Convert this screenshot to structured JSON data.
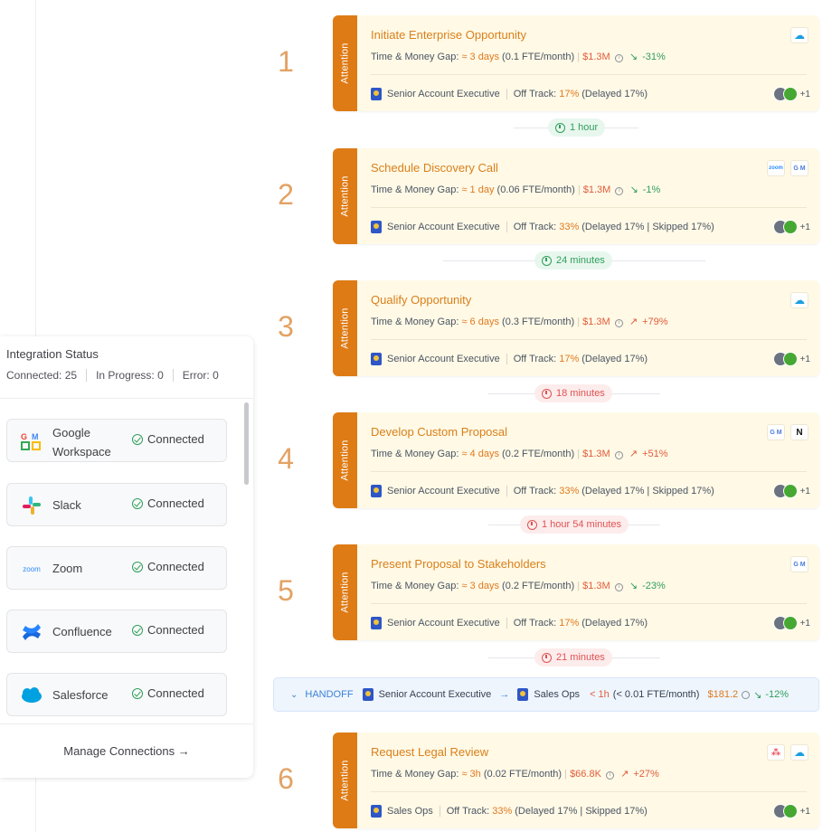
{
  "steps": [
    {
      "num": "1",
      "status": "Attention",
      "title": "Initiate Enterprise Opportunity",
      "gap_label": "Time & Money Gap:",
      "time_gap": "≈ 3 days",
      "fte": "(0.1 FTE/month)",
      "money": "$1.3M",
      "trend": "-31%",
      "trend_dir": "down",
      "role": "Senior Account Executive",
      "off_track_label": "Off Track:",
      "off_track_pct": "17%",
      "off_track_detail": "(Delayed 17%)",
      "avatars_more": "+1",
      "tools": [
        "salesforce-icon"
      ]
    },
    {
      "num": "2",
      "status": "Attention",
      "title": "Schedule Discovery Call",
      "gap_label": "Time & Money Gap:",
      "time_gap": "≈ 1 day",
      "fte": "(0.06 FTE/month)",
      "money": "$1.3M",
      "trend": "-1%",
      "trend_dir": "down",
      "role": "Senior Account Executive",
      "off_track_label": "Off Track:",
      "off_track_pct": "33%",
      "off_track_detail": "(Delayed 17% | Skipped 17%)",
      "avatars_more": "+1",
      "tools": [
        "zoom-icon",
        "google-workspace-icon"
      ]
    },
    {
      "num": "3",
      "status": "Attention",
      "title": "Qualify Opportunity",
      "gap_label": "Time & Money Gap:",
      "time_gap": "≈ 6 days",
      "fte": "(0.3 FTE/month)",
      "money": "$1.3M",
      "trend": "+79%",
      "trend_dir": "up",
      "role": "Senior Account Executive",
      "off_track_label": "Off Track:",
      "off_track_pct": "17%",
      "off_track_detail": "(Delayed 17%)",
      "avatars_more": "+1",
      "tools": [
        "salesforce-icon"
      ]
    },
    {
      "num": "4",
      "status": "Attention",
      "title": "Develop Custom Proposal",
      "gap_label": "Time & Money Gap:",
      "time_gap": "≈ 4 days",
      "fte": "(0.2 FTE/month)",
      "money": "$1.3M",
      "trend": "+51%",
      "trend_dir": "up",
      "role": "Senior Account Executive",
      "off_track_label": "Off Track:",
      "off_track_pct": "33%",
      "off_track_detail": "(Delayed 17% | Skipped 17%)",
      "avatars_more": "+1",
      "tools": [
        "google-workspace-icon",
        "notion-icon"
      ]
    },
    {
      "num": "5",
      "status": "Attention",
      "title": "Present Proposal to Stakeholders",
      "gap_label": "Time & Money Gap:",
      "time_gap": "≈ 3 days",
      "fte": "(0.2 FTE/month)",
      "money": "$1.3M",
      "trend": "-23%",
      "trend_dir": "down",
      "role": "Senior Account Executive",
      "off_track_label": "Off Track:",
      "off_track_pct": "17%",
      "off_track_detail": "(Delayed 17%)",
      "avatars_more": "+1",
      "tools": [
        "google-workspace-icon"
      ]
    },
    {
      "num": "6",
      "status": "Attention",
      "title": "Request Legal Review",
      "gap_label": "Time & Money Gap:",
      "time_gap": "≈ 3h",
      "fte": "(0.02 FTE/month)",
      "money": "$66.8K",
      "trend": "+27%",
      "trend_dir": "up",
      "role": "Sales Ops",
      "off_track_label": "Off Track:",
      "off_track_pct": "33%",
      "off_track_detail": "(Delayed 17% | Skipped 17%)",
      "avatars_more": "+1",
      "tools": [
        "asana-icon",
        "salesforce-icon"
      ]
    }
  ],
  "durations": [
    {
      "text": "1 hour",
      "tone": "green"
    },
    {
      "text": "24 minutes",
      "tone": "green"
    },
    {
      "text": "18 minutes",
      "tone": "red"
    },
    {
      "text": "1 hour 54 minutes",
      "tone": "red"
    },
    {
      "text": "21 minutes",
      "tone": "red"
    }
  ],
  "handoff": {
    "label": "HANDOFF",
    "from": "Senior Account Executive",
    "to": "Sales Ops",
    "time": "< 1h",
    "fte": "(< 0.01 FTE/month)",
    "money": "$181.2",
    "trend": "-12%"
  },
  "integration_panel": {
    "title": "Integration Status",
    "connected": "Connected: 25",
    "in_progress": "In Progress: 0",
    "error": "Error: 0",
    "items": [
      {
        "name": "Google Workspace",
        "status": "Connected",
        "icon": "google-workspace-icon"
      },
      {
        "name": "Slack",
        "status": "Connected",
        "icon": "slack-icon"
      },
      {
        "name": "Zoom",
        "status": "Connected",
        "icon": "zoom-icon"
      },
      {
        "name": "Confluence",
        "status": "Connected",
        "icon": "confluence-icon"
      },
      {
        "name": "Salesforce",
        "status": "Connected",
        "icon": "salesforce-icon"
      }
    ],
    "manage_label": "Manage Connections"
  },
  "colors": {
    "accent_orange": "#de7b15",
    "card_bg": "#fff9e6",
    "success_green": "#2f9e5b",
    "alert_red": "#e05252",
    "handoff_blue": "#3b82d6"
  }
}
